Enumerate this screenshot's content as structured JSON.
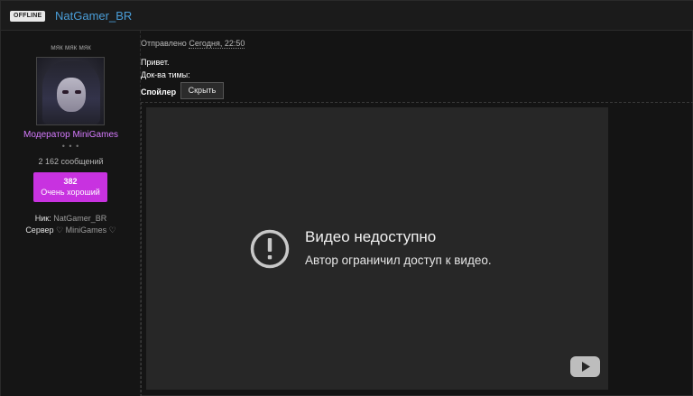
{
  "header": {
    "status_badge": "OFFLINE",
    "username": "NatGamer_BR"
  },
  "sidebar": {
    "user_title": "мяк мяк мяк",
    "role": "Модератор MiniGames",
    "dots": "• • •",
    "message_count": "2 162 сообщений",
    "reputation": {
      "value": "382",
      "label": "Очень хороший"
    },
    "nick": {
      "key": "Ник:",
      "value": "NatGamer_BR"
    },
    "server": {
      "key": "Сервер",
      "value": "♡ MiniGames ♡"
    }
  },
  "post": {
    "posted_prefix": "Отправлено",
    "posted_date": "Сегодня, 22:50",
    "line1": "Привет.",
    "line2": "Док-ва тимы:",
    "spoiler_label": "Спойлер",
    "spoiler_button": "Скрыть"
  },
  "video": {
    "title": "Видео недоступно",
    "subtitle": "Автор ограничил доступ к видео.",
    "alert_icon": "alert-circle-icon",
    "player_icon": "youtube-icon"
  },
  "colors": {
    "username": "#4a9ed9",
    "role": "#d67bff",
    "reputation_bg": "#c832e0",
    "background": "#141414",
    "video_bg": "#272727"
  }
}
